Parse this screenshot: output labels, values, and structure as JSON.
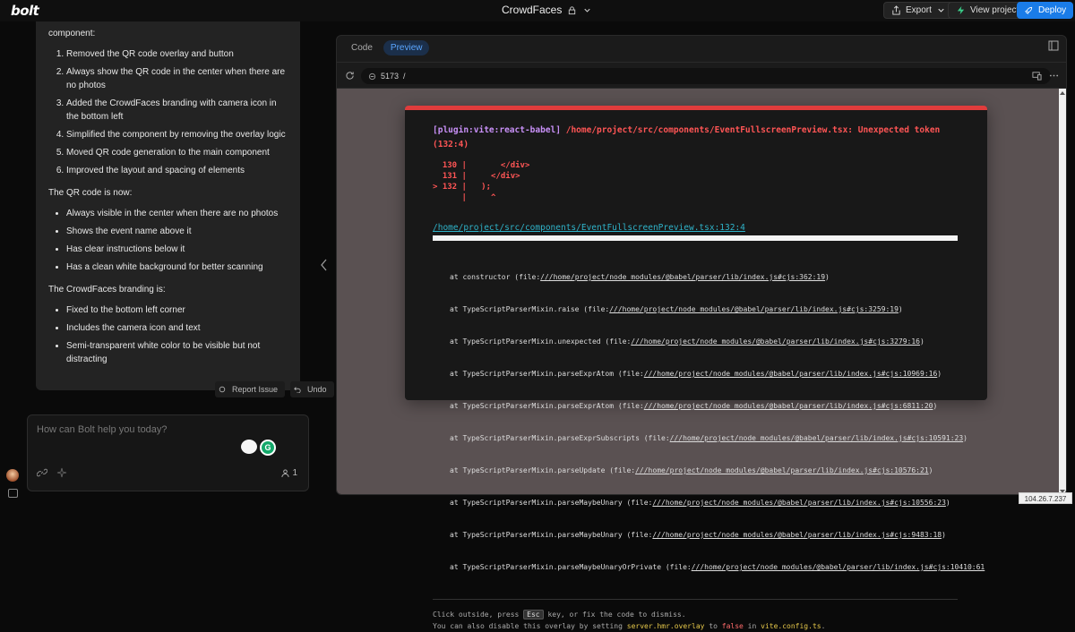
{
  "app": {
    "logo": "bolt"
  },
  "header": {
    "project_name": "CrowdFaces",
    "export_label": "Export",
    "view_project_label": "View project",
    "deploy_label": "Deploy"
  },
  "chat": {
    "intro": "component:",
    "changes": [
      "Removed the QR code overlay and button",
      "Always show the QR code in the center when there are no photos",
      "Added the CrowdFaces branding with camera icon in the bottom left",
      "Simplified the component by removing the overlay logic",
      "Moved QR code generation to the main component",
      "Improved the layout and spacing of elements"
    ],
    "qr_heading": "The QR code is now:",
    "qr_points": [
      "Always visible in the center when there are no photos",
      "Shows the event name above it",
      "Has clear instructions below it",
      "Has a clean white background for better scanning"
    ],
    "branding_heading": "The CrowdFaces branding is:",
    "branding_points": [
      "Fixed to the bottom left corner",
      "Includes the camera icon and text",
      "Semi-transparent white color to be visible but not distracting"
    ],
    "report_issue_label": "Report Issue",
    "undo_label": "Undo"
  },
  "prompt": {
    "placeholder": "How can Bolt help you today?",
    "count": "1"
  },
  "workbench": {
    "tabs": [
      "Code",
      "Preview"
    ],
    "active_tab": "Preview",
    "port": "5173",
    "path": "/"
  },
  "error_overlay": {
    "plugin": "[plugin:vite:react-babel]",
    "message": "/home/project/src/components/EventFullscreenPreview.tsx: Unexpected token (132:4)",
    "frame_lines": [
      "  130 |       </div>",
      "  131 |     </div>",
      "> 132 |   );",
      "      |     ^"
    ],
    "file_link": "/home/project/src/components/EventFullscreenPreview.tsx:132:4",
    "stack": [
      {
        "fn": "at constructor (file:",
        "link": "///home/project/node_modules/@babel/parser/lib/index.js#cjs:362:19",
        "end": ")"
      },
      {
        "fn": "at TypeScriptParserMixin.raise (file:",
        "link": "///home/project/node_modules/@babel/parser/lib/index.js#cjs:3259:19",
        "end": ")"
      },
      {
        "fn": "at TypeScriptParserMixin.unexpected (file:",
        "link": "///home/project/node_modules/@babel/parser/lib/index.js#cjs:3279:16",
        "end": ")"
      },
      {
        "fn": "at TypeScriptParserMixin.parseExprAtom (file:",
        "link": "///home/project/node_modules/@babel/parser/lib/index.js#cjs:10969:16",
        "end": ")"
      },
      {
        "fn": "at TypeScriptParserMixin.parseExprAtom (file:",
        "link": "///home/project/node_modules/@babel/parser/lib/index.js#cjs:6811:20",
        "end": ")"
      },
      {
        "fn": "at TypeScriptParserMixin.parseExprSubscripts (file:",
        "link": "///home/project/node_modules/@babel/parser/lib/index.js#cjs:10591:23",
        "end": ")"
      },
      {
        "fn": "at TypeScriptParserMixin.parseUpdate (file:",
        "link": "///home/project/node_modules/@babel/parser/lib/index.js#cjs:10576:21",
        "end": ")"
      },
      {
        "fn": "at TypeScriptParserMixin.parseMaybeUnary (file:",
        "link": "///home/project/node_modules/@babel/parser/lib/index.js#cjs:10556:23",
        "end": ")"
      },
      {
        "fn": "at TypeScriptParserMixin.parseMaybeUnary (file:",
        "link": "///home/project/node_modules/@babel/parser/lib/index.js#cjs:9483:18",
        "end": ")"
      },
      {
        "fn": "at TypeScriptParserMixin.parseMaybeUnaryOrPrivate (file:",
        "link": "///home/project/node_modules/@babel/parser/lib/index.js#cjs:10410:61",
        "end": ""
      }
    ],
    "tip1_pre": "Click outside, press",
    "tip1_key": "Esc",
    "tip1_post": "key, or fix the code to dismiss.",
    "tip2_pre": "You can also disable this overlay by setting",
    "tip2_setting": "server.hmr.overlay",
    "tip2_mid": "to",
    "tip2_value": "false",
    "tip2_in": "in",
    "tip2_file": "vite.config.ts",
    "tip2_end": "."
  },
  "status": {
    "ip": "104.26.7.237"
  },
  "colors": {
    "accent": "#1a7ce8",
    "error": "#e03c3c",
    "link": "#2fb3c9",
    "plugin": "#c890f7"
  }
}
